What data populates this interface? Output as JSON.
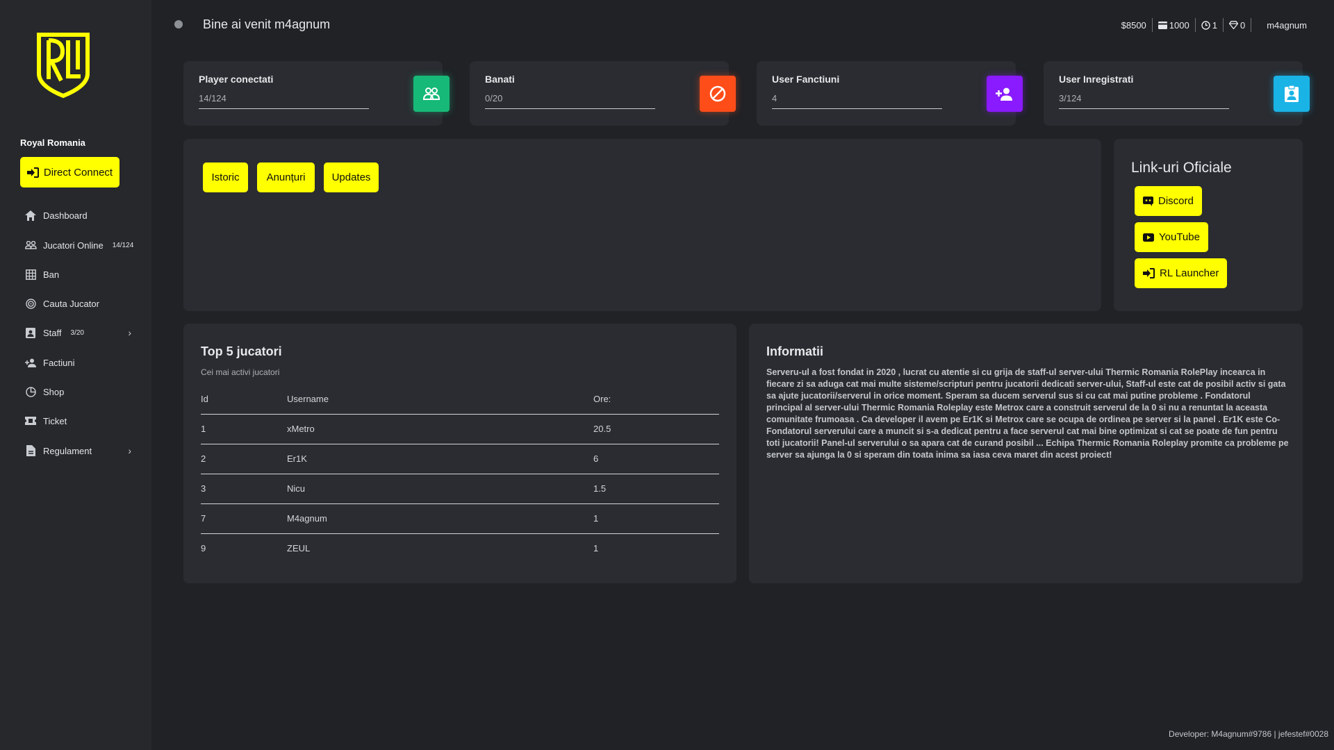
{
  "sidebar": {
    "brand": "Royal Romania",
    "direct_connect": "Direct Connect",
    "items": [
      {
        "label": "Dashboard",
        "icon": "home-icon"
      },
      {
        "label": "Jucatori Online",
        "badge": "14/124",
        "icon": "users-icon"
      },
      {
        "label": "Ban",
        "icon": "grid-icon"
      },
      {
        "label": "Cauta Jucator",
        "icon": "search-player-icon"
      },
      {
        "label": "Staff",
        "badge": "3/20",
        "icon": "badge-icon"
      },
      {
        "label": "Factiuni",
        "icon": "person-add-icon"
      },
      {
        "label": "Shop",
        "icon": "pie-icon"
      },
      {
        "label": "Ticket",
        "icon": "ticket-icon"
      },
      {
        "label": "Regulament",
        "icon": "document-icon"
      }
    ]
  },
  "header": {
    "welcome": "Bine ai venit m4agnum",
    "money": "$8500",
    "cards": "1000",
    "hours": "1",
    "diamonds": "0",
    "username": "m4agnum"
  },
  "stats": [
    {
      "title": "Player conectati",
      "value": "14/124",
      "color": "#17b978",
      "icon": "users-icon"
    },
    {
      "title": "Banati",
      "value": "0/20",
      "color": "#ff4d1a",
      "icon": "ban-icon"
    },
    {
      "title": "User Fanctiuni",
      "value": "4",
      "color": "#8a1aff",
      "icon": "person-add-icon"
    },
    {
      "title": "User Inregistrati",
      "value": "3/124",
      "color": "#1ab3e6",
      "icon": "badge-icon"
    }
  ],
  "tabs": [
    "Istoric",
    "Anunțuri",
    "Updates"
  ],
  "links": {
    "title": "Link-uri Oficiale",
    "items": [
      "Discord",
      "YouTube",
      "RL Launcher"
    ]
  },
  "top": {
    "title": "Top 5 jucatori",
    "subtitle": "Cei mai activi jucatori",
    "headers": [
      "Id",
      "Username",
      "Ore:"
    ],
    "rows": [
      [
        "1",
        "xMetro",
        "20.5"
      ],
      [
        "2",
        "Er1K",
        "6"
      ],
      [
        "3",
        "Nicu",
        "1.5"
      ],
      [
        "7",
        "M4agnum",
        "1"
      ],
      [
        "9",
        "ZEUL",
        "1"
      ]
    ]
  },
  "info": {
    "title": "Informatii",
    "text": "Serveru-ul a fost fondat in 2020 , lucrat cu atentie si cu grija de staff-ul server-ului Thermic Romania RolePlay incearca in fiecare zi sa aduga cat mai multe sisteme/scripturi pentru jucatorii dedicati server-ului, Staff-ul este cat de posibil activ si gata sa ajute jucatorii/serverul in orice moment. Speram sa ducem serverul sus si cu cat mai putine probleme . Fondatorul principal al server-ului Thermic Romania Roleplay este Metrox care a construit serverul de la 0 si nu a renuntat la aceasta comunitate frumoasa . Ca developer il avem pe Er1K si Metrox care se ocupa de ordinea pe server si la panel . Er1K este Co-Fondatorul serverului care a muncit si s-a dedicat pentru a face serverul cat mai bine optimizat si cat se poate de fun pentru toti jucatorii! Panel-ul serverului o sa apara cat de curand posibil ... Echipa Thermic Romania Roleplay promite ca probleme pe server sa ajunga la 0 si speram din toata inima sa iasa ceva maret din acest proiect!"
  },
  "footer": "Developer: M4agnum#9786 | jefestef#0028",
  "colors": {
    "accent": "#ffff00",
    "background": "#202226",
    "card": "#2a2c31",
    "sidebar": "#26282c"
  }
}
